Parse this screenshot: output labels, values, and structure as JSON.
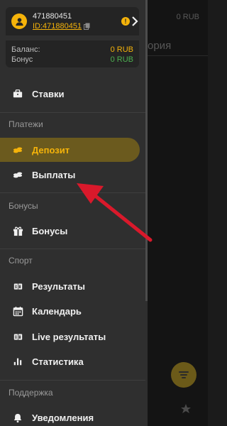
{
  "background": {
    "balance_text": "0 RUB",
    "tab_text": "ория",
    "nav_label": "Избранное"
  },
  "account": {
    "login": "471880451",
    "id_text": "ID:471880451",
    "alert": "!"
  },
  "balance": {
    "balance_label": "Баланс:",
    "balance_value": "0 RUB",
    "bonus_label": "Бонус",
    "bonus_value": "0 RUB"
  },
  "menu": {
    "bets": "Ставки",
    "payments_section": "Платежи",
    "deposit": "Депозит",
    "payouts": "Выплаты",
    "bonuses_section": "Бонусы",
    "bonuses": "Бонусы",
    "sport_section": "Спорт",
    "results": "Результаты",
    "calendar": "Календарь",
    "live_results": "Live результаты",
    "statistics": "Статистика",
    "support_section": "Поддержка",
    "notifications": "Уведомления"
  },
  "colors": {
    "accent": "#f5b30a",
    "drawer_bg": "#2f2f2f",
    "active_bg": "#6b5a1e",
    "bonus_green": "#4caf50",
    "annotation_arrow": "#d9192b"
  }
}
